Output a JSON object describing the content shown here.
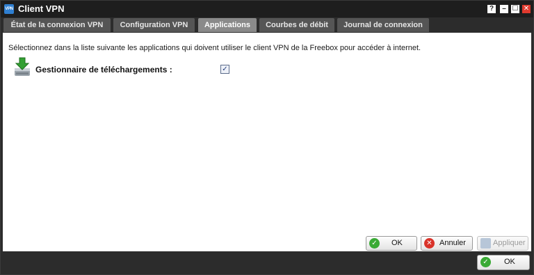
{
  "window": {
    "app_icon_text": "VPN",
    "title": "Client VPN",
    "help_glyph": "?",
    "minimize_glyph": "–",
    "maximize_glyph": "☐",
    "close_glyph": "✕"
  },
  "tabs": [
    {
      "label": "État de la connexion VPN",
      "active": false
    },
    {
      "label": "Configuration VPN",
      "active": false
    },
    {
      "label": "Applications",
      "active": true
    },
    {
      "label": "Courbes de débit",
      "active": false
    },
    {
      "label": "Journal de connexion",
      "active": false
    }
  ],
  "content": {
    "intro": "Sélectionnez dans la liste suivante les applications qui doivent utiliser le client VPN de la Freebox pour accéder à internet.",
    "options": [
      {
        "label": "Gestionnaire de téléchargements :",
        "checked": true,
        "icon": "download-manager-icon"
      }
    ],
    "buttons": {
      "ok": "OK",
      "cancel": "Annuler",
      "apply": "Appliquer"
    }
  },
  "footer": {
    "ok": "OK"
  },
  "colors": {
    "ok_icon": "#3aaa35",
    "cancel_icon": "#d9332a",
    "active_tab": "#8a8a8a"
  }
}
